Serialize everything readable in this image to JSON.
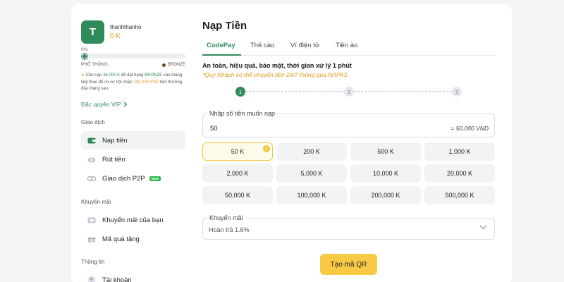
{
  "user": {
    "avatar_letter": "T",
    "username": "thanhthanho",
    "balance": "0 K",
    "progress_percent": "0%",
    "progress_value": 0,
    "rank_current": "PHỔ THÔNG",
    "rank_next": "BRONZE",
    "notice_prefix": "Cần nạp ",
    "notice_amount": "36,000 K",
    "notice_mid": " để đạt hạng ",
    "notice_rank": "BRONZE",
    "notice_mid2": " vào tháng tiếp theo để có cơ hội nhận ",
    "notice_reward": "100,000 VND",
    "notice_suffix": " tiền thưởng đầu tháng sau",
    "vip_link": "Đặc quyền VIP"
  },
  "sidebar": {
    "section_transactions": "Giao dịch",
    "deposit": "Nạp tiền",
    "withdraw": "Rút tiền",
    "p2p": "Giao dịch P2P",
    "new_badge": "NEW",
    "section_promotions": "Khuyến mãi",
    "my_promotions": "Khuyến mãi của bạn",
    "gift_code": "Mã quà tặng",
    "section_info": "Thông tin",
    "account": "Tài khoản"
  },
  "main": {
    "title": "Nạp Tiền",
    "tabs": [
      "CodePay",
      "Thẻ cào",
      "Ví điện tử",
      "Tiền ảo"
    ],
    "subtitle": "An toàn, hiệu quả, bảo mật, thời gian xử lý 1 phút",
    "napas_note": "*Quý Khách có thể chuyển tiền 24/7 thông qua NAPAS",
    "steps": [
      "1",
      "2",
      "3"
    ]
  },
  "amount": {
    "label": "Nhập số tiền muốn nạp",
    "value": "50",
    "converted": "= 50,000 VND"
  },
  "amount_options": [
    "50 K",
    "200 K",
    "500 K",
    "1,000 K",
    "2,000 K",
    "5,000 K",
    "10,000 K",
    "20,000 K",
    "50,000 K",
    "100,000 K",
    "200,000 K",
    "500,000 K"
  ],
  "promo": {
    "label": "Khuyến mãi",
    "value": "Hoàn trả 1.6%"
  },
  "submit_label": "Tạo mã QR",
  "colors": {
    "accent": "#2f8a5c",
    "highlight": "#e09b1a",
    "button": "#f7c945"
  }
}
